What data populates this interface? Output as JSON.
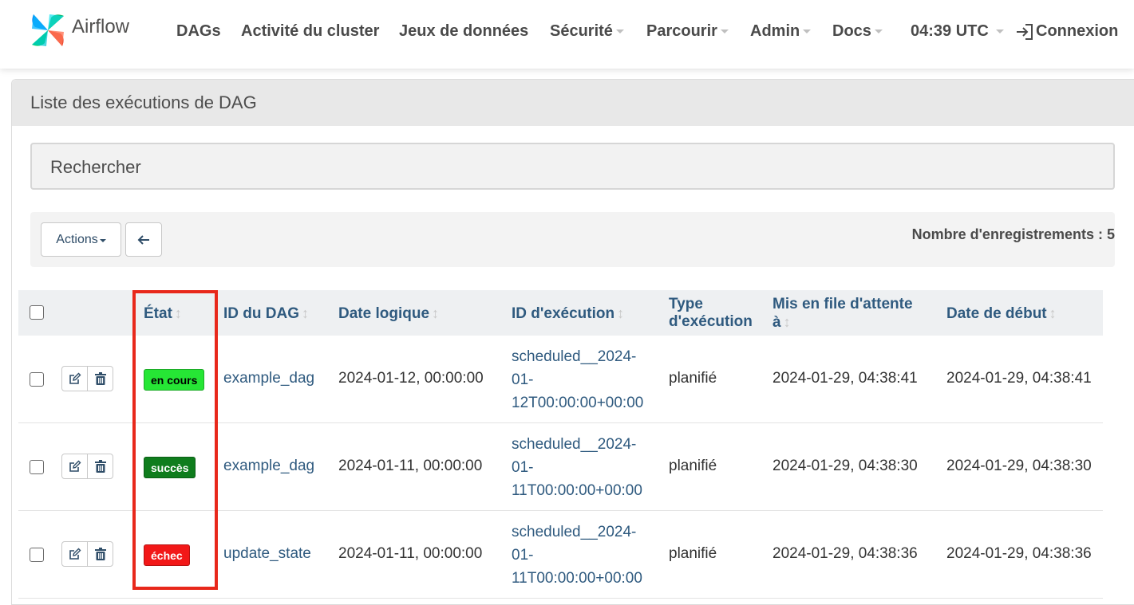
{
  "navbar": {
    "brand": "Airflow",
    "items": [
      "DAGs",
      "Activité du cluster",
      "Jeux de données",
      "Sécurité",
      "Parcourir",
      "Admin",
      "Docs"
    ],
    "time": "04:39 UTC",
    "login": "Connexion"
  },
  "panel": {
    "title": "Liste des exécutions de DAG",
    "search_placeholder": "Rechercher",
    "actions_label": "Actions",
    "back_icon": "arrow-left-icon",
    "record_count": "Nombre d'enregistrements : 5"
  },
  "table": {
    "headers": {
      "state": "État",
      "dag_id": "ID du DAG",
      "logical_date": "Date logique",
      "run_id": "ID d'exécution",
      "run_type_l1": "Type",
      "run_type_l2": "d'exécution",
      "queued_l1": "Mis en file d'attente",
      "queued_l2": "à",
      "start_date": "Date de début"
    },
    "rows": [
      {
        "state": "en cours",
        "state_bg": "#26e635",
        "state_fg": "#000000",
        "dag_id": "example_dag",
        "logical_date": "2024-01-12, 00:00:00",
        "run_id_l1": "scheduled__2024-",
        "run_id_l2": "01-",
        "run_id_l3": "12T00:00:00+00:00",
        "run_type": "planifié",
        "queued_at": "2024-01-29, 04:38:41",
        "start_date": "2024-01-29, 04:38:41"
      },
      {
        "state": "succès",
        "state_bg": "#0f7d1d",
        "state_fg": "#ffffff",
        "dag_id": "example_dag",
        "logical_date": "2024-01-11, 00:00:00",
        "run_id_l1": "scheduled__2024-",
        "run_id_l2": "01-",
        "run_id_l3": "11T00:00:00+00:00",
        "run_type": "planifié",
        "queued_at": "2024-01-29, 04:38:30",
        "start_date": "2024-01-29, 04:38:30"
      },
      {
        "state": "échec",
        "state_bg": "#f21818",
        "state_fg": "#ffffff",
        "dag_id": "update_state",
        "logical_date": "2024-01-11, 00:00:00",
        "run_id_l1": "scheduled__2024-",
        "run_id_l2": "01-",
        "run_id_l3": "11T00:00:00+00:00",
        "run_type": "planifié",
        "queued_at": "2024-01-29, 04:38:36",
        "start_date": "2024-01-29, 04:38:36"
      }
    ]
  },
  "colors": {
    "link": "#2f5a7f",
    "highlight": "#e8281b"
  }
}
